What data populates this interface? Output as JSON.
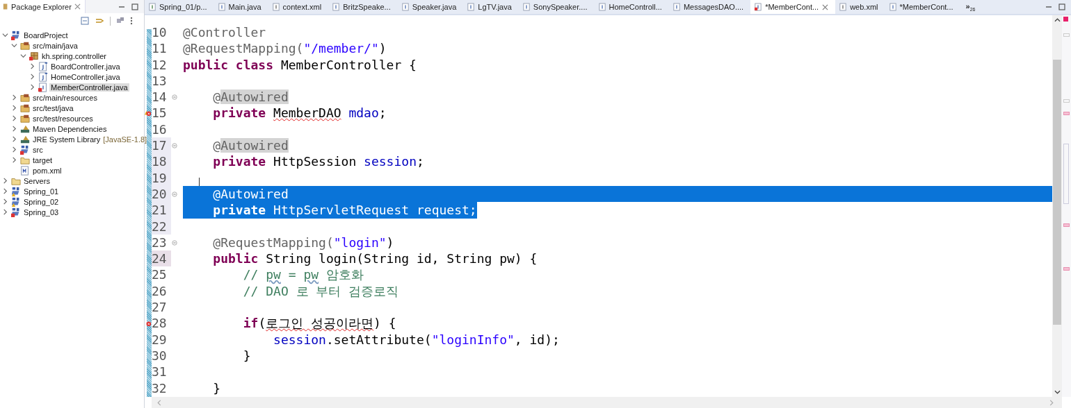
{
  "explorer": {
    "title": "Package Explorer",
    "tree": [
      {
        "label": "BoardProject",
        "kind": "project",
        "expanded": true,
        "selected": false,
        "children": [
          {
            "label": "src/main/java",
            "kind": "source-folder",
            "expanded": true,
            "selected": false,
            "children": [
              {
                "label": "kh.spring.controller",
                "kind": "package",
                "expanded": true,
                "selected": false,
                "children": [
                  {
                    "label": "BoardController.java",
                    "kind": "java-file",
                    "expanded": false,
                    "selected": false
                  },
                  {
                    "label": "HomeController.java",
                    "kind": "java-file",
                    "expanded": false,
                    "selected": false
                  },
                  {
                    "label": "MemberController.java",
                    "kind": "java-file-error",
                    "expanded": false,
                    "selected": true
                  }
                ]
              }
            ]
          },
          {
            "label": "src/main/resources",
            "kind": "source-folder",
            "expanded": false,
            "selected": false
          },
          {
            "label": "src/test/java",
            "kind": "source-folder",
            "expanded": false,
            "selected": false
          },
          {
            "label": "src/test/resources",
            "kind": "source-folder",
            "expanded": false,
            "selected": false
          },
          {
            "label": "Maven Dependencies",
            "kind": "library",
            "expanded": false,
            "selected": false
          },
          {
            "label": "JRE System Library",
            "decoration": "[JavaSE-1.8]",
            "kind": "library",
            "expanded": false,
            "selected": false
          },
          {
            "label": "src",
            "kind": "project",
            "expanded": false,
            "selected": false
          },
          {
            "label": "target",
            "kind": "folder",
            "expanded": false,
            "selected": false
          },
          {
            "label": "pom.xml",
            "kind": "xml-file",
            "selected": false
          }
        ]
      },
      {
        "label": "Servers",
        "kind": "folder",
        "expanded": false,
        "selected": false
      },
      {
        "label": "Spring_01",
        "kind": "project-warning",
        "expanded": false,
        "selected": false
      },
      {
        "label": "Spring_02",
        "kind": "project-warning",
        "expanded": false,
        "selected": false
      },
      {
        "label": "Spring_03",
        "kind": "project",
        "expanded": false,
        "selected": false
      }
    ]
  },
  "tabs": [
    {
      "label": "Spring_01/p...",
      "kind": "jsp",
      "selected": false
    },
    {
      "label": "Main.java",
      "kind": "java",
      "selected": false
    },
    {
      "label": "context.xml",
      "kind": "xml",
      "selected": false
    },
    {
      "label": "BritzSpeake...",
      "kind": "java",
      "selected": false
    },
    {
      "label": "Speaker.java",
      "kind": "java",
      "selected": false
    },
    {
      "label": "LgTV.java",
      "kind": "java",
      "selected": false
    },
    {
      "label": "SonySpeaker....",
      "kind": "java",
      "selected": false
    },
    {
      "label": "HomeControll...",
      "kind": "java",
      "selected": false
    },
    {
      "label": "MessagesDAO....",
      "kind": "java",
      "selected": false
    },
    {
      "label": "*MemberCont...",
      "kind": "java-error",
      "selected": true
    },
    {
      "label": "web.xml",
      "kind": "xml",
      "selected": false
    },
    {
      "label": "*MemberCont...",
      "kind": "java",
      "selected": false
    }
  ],
  "tab_overflow": {
    "chevron": "»",
    "count": "26"
  },
  "editor": {
    "lines": [
      {
        "number": "10",
        "fold": false,
        "error": false,
        "warning": false,
        "current": false,
        "range": false,
        "selected": false,
        "tokens": [
          {
            "text": "@Controller",
            "kind": "annotation"
          }
        ]
      },
      {
        "number": "11",
        "fold": false,
        "error": false,
        "warning": false,
        "current": false,
        "range": false,
        "selected": false,
        "tokens": [
          {
            "text": "@RequestMapping(",
            "kind": "annotation"
          },
          {
            "text": "\"/member/\"",
            "kind": "string"
          },
          {
            "text": ")",
            "kind": "plain"
          }
        ]
      },
      {
        "number": "12",
        "fold": false,
        "error": false,
        "warning": false,
        "current": false,
        "range": false,
        "selected": false,
        "tokens": [
          {
            "text": "public class",
            "kind": "keyword"
          },
          {
            "text": " MemberController {",
            "kind": "plain"
          }
        ]
      },
      {
        "number": "13",
        "fold": false,
        "error": false,
        "warning": false,
        "current": false,
        "range": false,
        "selected": false
      },
      {
        "number": "14",
        "fold": true,
        "error": false,
        "warning": false,
        "current": false,
        "range": false,
        "selected": false,
        "tokens": [
          {
            "text": "    @",
            "kind": "annotation"
          },
          {
            "text": "Autowired",
            "kind": "occurrence"
          }
        ]
      },
      {
        "number": "15",
        "fold": false,
        "error": true,
        "warning": true,
        "current": false,
        "range": false,
        "selected": false,
        "tokens": [
          {
            "text": "    private ",
            "kind": "keyword"
          },
          {
            "text": "MemberDAO",
            "kind": "error"
          },
          {
            "text": " mdao",
            "kind": "field"
          },
          {
            "text": ";",
            "kind": "plain"
          }
        ]
      },
      {
        "number": "16",
        "fold": false,
        "error": false,
        "warning": false,
        "current": false,
        "range": false,
        "selected": false
      },
      {
        "number": "17",
        "fold": true,
        "error": false,
        "warning": false,
        "current": false,
        "range": true,
        "selected": false,
        "tokens": [
          {
            "text": "    @",
            "kind": "annotation"
          },
          {
            "text": "Autowired",
            "kind": "occurrence"
          }
        ]
      },
      {
        "number": "18",
        "fold": false,
        "error": false,
        "warning": false,
        "current": false,
        "range": true,
        "selected": false,
        "tokens": [
          {
            "text": "    private",
            "kind": "keyword"
          },
          {
            "text": " HttpSession ",
            "kind": "plain"
          },
          {
            "text": "session",
            "kind": "field"
          },
          {
            "text": ";",
            "kind": "plain"
          }
        ]
      },
      {
        "number": "19",
        "fold": false,
        "error": false,
        "warning": false,
        "current": false,
        "range": true,
        "selected": false
      },
      {
        "number": "20",
        "fold": true,
        "error": false,
        "warning": false,
        "current": false,
        "range": true,
        "selected": true,
        "tokens": [
          {
            "text": "    @Autowired",
            "kind": "annotation"
          }
        ]
      },
      {
        "number": "21",
        "fold": false,
        "error": false,
        "warning": false,
        "current": false,
        "range": true,
        "selected": true,
        "tokens": [
          {
            "text": "    private",
            "kind": "keyword"
          },
          {
            "text": " HttpServletRequest ",
            "kind": "plain"
          },
          {
            "text": "request",
            "kind": "field"
          },
          {
            "text": ";",
            "kind": "plain"
          }
        ]
      },
      {
        "number": "22",
        "fold": false,
        "error": false,
        "warning": false,
        "current": false,
        "range": true,
        "selected": false
      },
      {
        "number": "23",
        "fold": true,
        "error": false,
        "warning": false,
        "current": false,
        "range": false,
        "selected": false,
        "tokens": [
          {
            "text": "    @RequestMapping(",
            "kind": "annotation"
          },
          {
            "text": "\"login\"",
            "kind": "string"
          },
          {
            "text": ")",
            "kind": "plain"
          }
        ]
      },
      {
        "number": "24",
        "fold": false,
        "error": false,
        "warning": false,
        "current": true,
        "range": false,
        "selected": false,
        "tokens": [
          {
            "text": "    public",
            "kind": "keyword"
          },
          {
            "text": " String login(String id, String pw) {",
            "kind": "plain"
          }
        ]
      },
      {
        "number": "25",
        "fold": false,
        "error": false,
        "warning": false,
        "current": false,
        "range": false,
        "selected": false,
        "tokens": [
          {
            "text": "        // ",
            "kind": "comment"
          },
          {
            "text": "pw",
            "kind": "comment-spelling"
          },
          {
            "text": " = ",
            "kind": "comment"
          },
          {
            "text": "pw",
            "kind": "comment-spelling"
          },
          {
            "text": " 암호화",
            "kind": "comment"
          }
        ]
      },
      {
        "number": "26",
        "fold": false,
        "error": false,
        "warning": false,
        "current": false,
        "range": false,
        "selected": false,
        "tokens": [
          {
            "text": "        // DAO 로 부터 검증로직",
            "kind": "comment"
          }
        ]
      },
      {
        "number": "27",
        "fold": false,
        "error": false,
        "warning": false,
        "current": false,
        "range": false,
        "selected": false
      },
      {
        "number": "28",
        "fold": false,
        "error": true,
        "warning": false,
        "current": false,
        "range": false,
        "selected": false,
        "tokens": [
          {
            "text": "        if",
            "kind": "keyword"
          },
          {
            "text": "(",
            "kind": "plain"
          },
          {
            "text": "로그인 성공이라면",
            "kind": "error"
          },
          {
            "text": ") {",
            "kind": "plain"
          }
        ]
      },
      {
        "number": "29",
        "fold": false,
        "error": false,
        "warning": false,
        "current": false,
        "range": false,
        "selected": false,
        "tokens": [
          {
            "text": "            session",
            "kind": "field"
          },
          {
            "text": ".setAttribute(",
            "kind": "plain"
          },
          {
            "text": "\"loginInfo\"",
            "kind": "string"
          },
          {
            "text": ", id);",
            "kind": "plain"
          }
        ]
      },
      {
        "number": "30",
        "fold": false,
        "error": false,
        "warning": false,
        "current": false,
        "range": false,
        "selected": false,
        "tokens": [
          {
            "text": "        }",
            "kind": "plain"
          }
        ]
      },
      {
        "number": "31",
        "fold": false,
        "error": false,
        "warning": false,
        "current": false,
        "range": false,
        "selected": false
      },
      {
        "number": "32",
        "fold": false,
        "error": false,
        "warning": false,
        "current": false,
        "range": false,
        "selected": false,
        "tokens": [
          {
            "text": "    }",
            "kind": "plain"
          }
        ]
      }
    ]
  }
}
